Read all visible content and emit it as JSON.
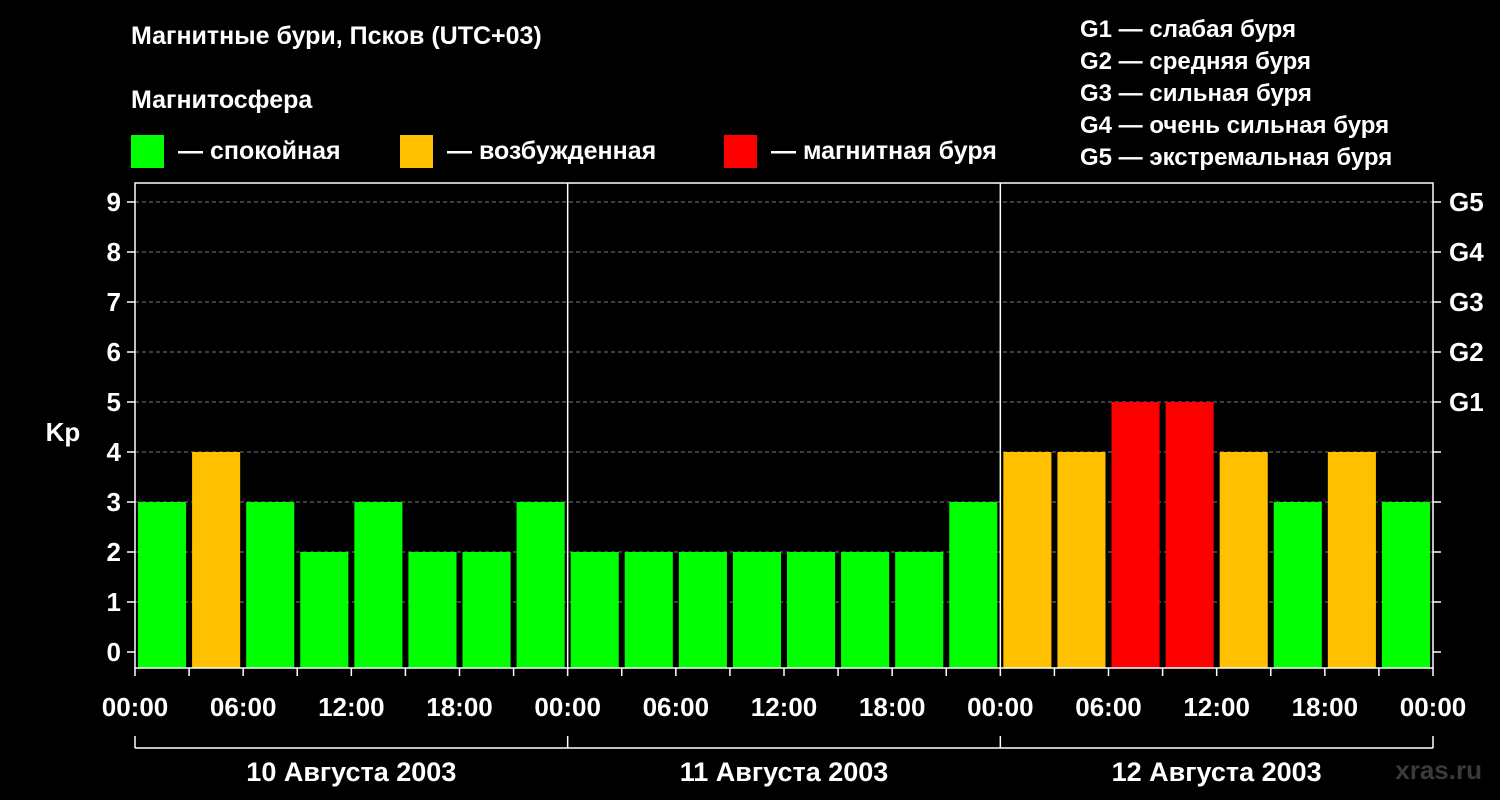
{
  "header": {
    "title": "Магнитные бури, Псков (UTC+03)",
    "subtitle": "Магнитосфера"
  },
  "legend": [
    {
      "label": "— спокойная",
      "color": "#00ff00"
    },
    {
      "label": "— возбужденная",
      "color": "#ffc000"
    },
    {
      "label": "— магнитная буря",
      "color": "#ff0000"
    }
  ],
  "storm_levels": [
    "G1 — слабая буря",
    "G2 — средняя буря",
    "G3 — сильная буря",
    "G4 — очень сильная буря",
    "G5 — экстремальная буря"
  ],
  "watermark": "xras.ru",
  "chart_data": {
    "type": "bar",
    "title": "Магнитные бури, Псков (UTC+03)",
    "ylabel": "Kp",
    "ylim": [
      0,
      9
    ],
    "yticks": [
      0,
      1,
      2,
      3,
      4,
      5,
      6,
      7,
      8,
      9
    ],
    "right_ticks": [
      {
        "value": 5,
        "label": "G1"
      },
      {
        "value": 6,
        "label": "G2"
      },
      {
        "value": 7,
        "label": "G3"
      },
      {
        "value": 8,
        "label": "G4"
      },
      {
        "value": 9,
        "label": "G5"
      }
    ],
    "xtick_labels": [
      "00:00",
      "06:00",
      "12:00",
      "18:00",
      "00:00",
      "06:00",
      "12:00",
      "18:00",
      "00:00",
      "06:00",
      "12:00",
      "18:00",
      "00:00"
    ],
    "days": [
      "10 Августа 2003",
      "11 Августа 2003",
      "12 Августа 2003"
    ],
    "interval_hours": 3,
    "values": [
      3,
      4,
      3,
      2,
      3,
      2,
      2,
      3,
      2,
      2,
      2,
      2,
      2,
      2,
      2,
      3,
      4,
      4,
      5,
      5,
      4,
      3,
      4,
      3
    ],
    "colors": {
      "quiet": "#00ff00",
      "active": "#ffc000",
      "storm": "#ff0000"
    },
    "grid": true
  }
}
